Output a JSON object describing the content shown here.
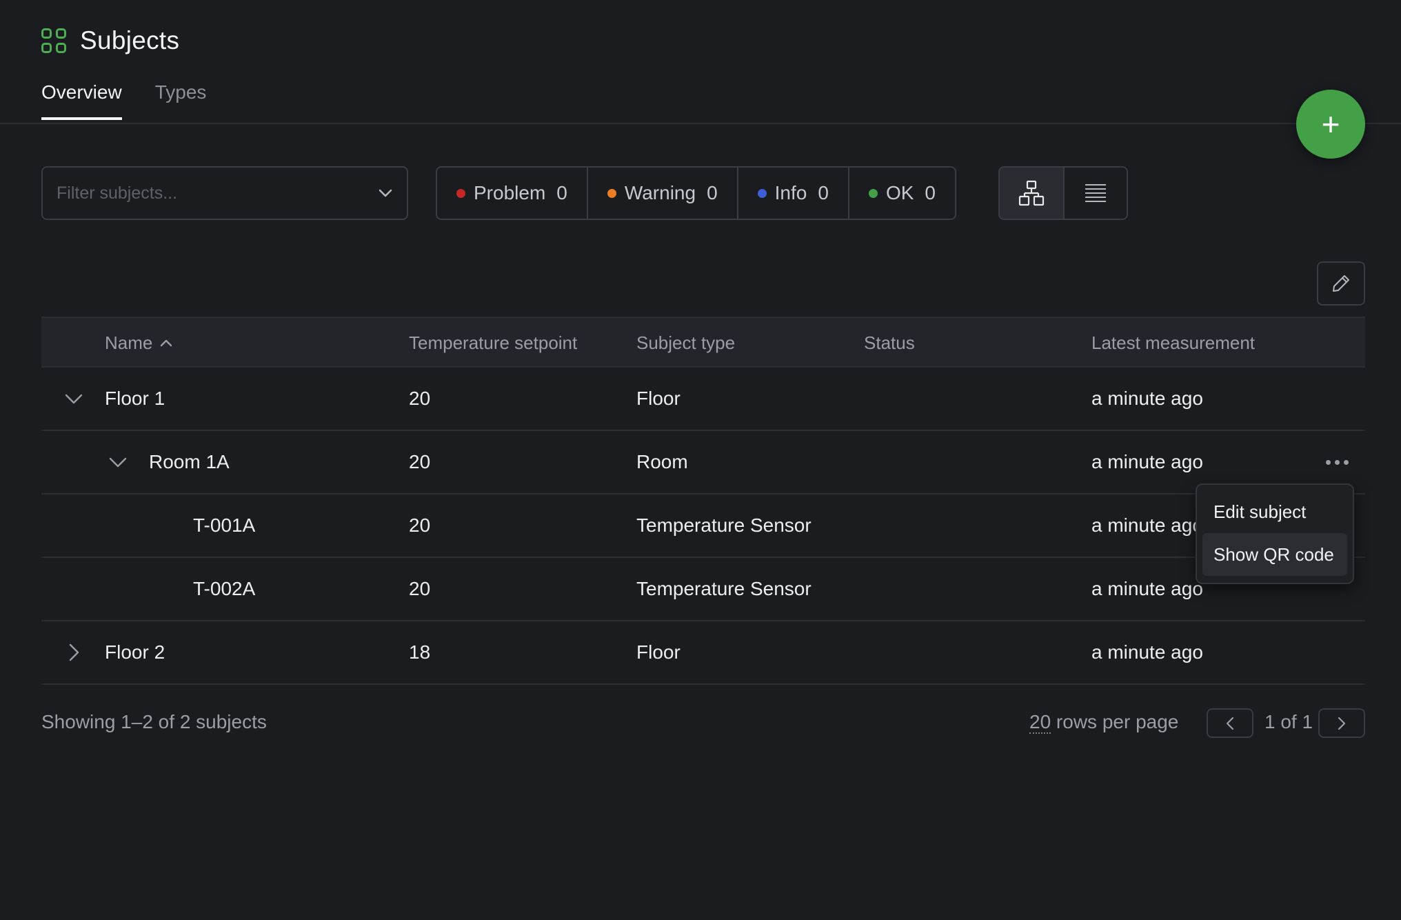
{
  "header": {
    "title": "Subjects",
    "icon": "grid-icon",
    "accent_color": "#4caf50"
  },
  "tabs": [
    {
      "label": "Overview",
      "active": true
    },
    {
      "label": "Types",
      "active": false
    }
  ],
  "fab": {
    "label": "+",
    "icon": "plus-icon",
    "color": "#43a047"
  },
  "filter": {
    "placeholder": "Filter subjects..."
  },
  "status_filters": [
    {
      "label": "Problem",
      "count": "0",
      "color": "#c62828"
    },
    {
      "label": "Warning",
      "count": "0",
      "color": "#ef7d22"
    },
    {
      "label": "Info",
      "count": "0",
      "color": "#3f5fd6"
    },
    {
      "label": "OK",
      "count": "0",
      "color": "#43a047"
    }
  ],
  "view_toggle": {
    "tree_icon": "hierarchy-icon",
    "list_icon": "list-icon",
    "active": "tree"
  },
  "table": {
    "columns": {
      "name": "Name",
      "setpoint": "Temperature setpoint",
      "type": "Subject type",
      "status": "Status",
      "latest": "Latest measurement"
    },
    "sort": {
      "column": "name",
      "direction": "ascending"
    },
    "rows": [
      {
        "name": "Floor 1",
        "setpoint": "20",
        "type": "Floor",
        "status": "",
        "latest": "a minute ago",
        "level": 0,
        "expander": "expanded"
      },
      {
        "name": "Room 1A",
        "setpoint": "20",
        "type": "Room",
        "status": "",
        "latest": "a minute ago",
        "level": 1,
        "expander": "expanded"
      },
      {
        "name": "T-001A",
        "setpoint": "20",
        "type": "Temperature Sensor",
        "status": "",
        "latest": "a minute ago",
        "level": 2,
        "expander": "none"
      },
      {
        "name": "T-002A",
        "setpoint": "20",
        "type": "Temperature Sensor",
        "status": "",
        "latest": "a minute ago",
        "level": 2,
        "expander": "none"
      },
      {
        "name": "Floor 2",
        "setpoint": "18",
        "type": "Floor",
        "status": "",
        "latest": "a minute ago",
        "level": 0,
        "expander": "collapsed"
      }
    ]
  },
  "context_menu": {
    "items": [
      {
        "label": "Edit subject"
      },
      {
        "label": "Show QR code"
      }
    ]
  },
  "footer": {
    "summary": "Showing 1–2 of 2 subjects",
    "rows_per_page_value": "20",
    "rows_per_page_suffix": " rows per page",
    "page_text": "1 of 1"
  }
}
